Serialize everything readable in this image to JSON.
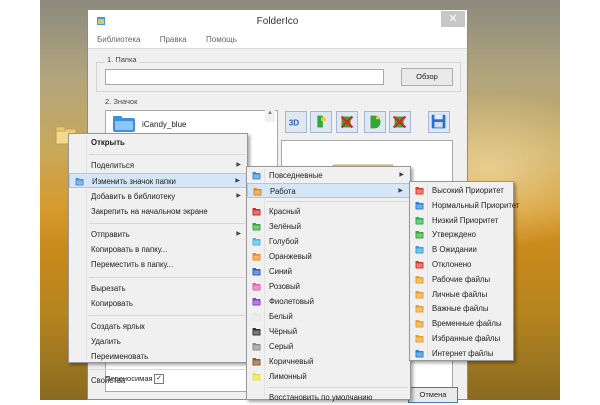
{
  "window": {
    "title": "FolderIco",
    "close_glyph": "✕"
  },
  "menubar": [
    "Библиотека",
    "Правка",
    "Помощь"
  ],
  "folder_group": {
    "label": "1. Папка",
    "path_value": "",
    "browse_label": "Обзор"
  },
  "icon_group": {
    "label": "2. Значок",
    "items": [
      {
        "name": "iCandy_blue"
      }
    ]
  },
  "toolbar_icons": [
    "3d-icon",
    "green-flag-icon",
    "green-x-icon",
    "green-d-icon",
    "red-x-icon",
    "save-icon"
  ],
  "bottom": {
    "checkbox_label": "Переносимая",
    "checkbox_checked": true,
    "checkbox_glyph": "✓",
    "cancel_label": "Отмена"
  },
  "context_menu": {
    "items": [
      {
        "label": "Открыть",
        "bold": true
      },
      {
        "sep": true
      },
      {
        "label": "Поделиться",
        "submenu": true
      },
      {
        "label": "Изменить значок папки",
        "submenu": true,
        "highlight": true,
        "icon": "folder-ico-icon"
      },
      {
        "label": "Добавить в библиотеку",
        "submenu": true
      },
      {
        "label": "Закрепить на начальном экране"
      },
      {
        "sep": true
      },
      {
        "label": "Отправить",
        "submenu": true
      },
      {
        "label": "Копировать в папку..."
      },
      {
        "label": "Переместить в папку..."
      },
      {
        "sep": true
      },
      {
        "label": "Вырезать"
      },
      {
        "label": "Копировать"
      },
      {
        "sep": true
      },
      {
        "label": "Создать ярлык"
      },
      {
        "label": "Удалить"
      },
      {
        "label": "Переименовать"
      },
      {
        "sep": true
      },
      {
        "label": "Свойства"
      }
    ]
  },
  "submenu_icons": {
    "items": [
      {
        "label": "Повседневные",
        "submenu": true,
        "icon": "everyday-icon",
        "color": "#3a8fd9"
      },
      {
        "label": "Работа",
        "submenu": true,
        "highlight": true,
        "icon": "work-icon",
        "color": "#e08a1e"
      },
      {
        "sep": true
      },
      {
        "label": "Красный",
        "icon": "red-folder-icon",
        "color": "#d42a2a"
      },
      {
        "label": "Зелёный",
        "icon": "green-folder-icon",
        "color": "#3aa63a"
      },
      {
        "label": "Голубой",
        "icon": "lightblue-folder-icon",
        "color": "#48b4e8"
      },
      {
        "label": "Оранжевый",
        "icon": "orange-folder-icon",
        "color": "#f08a1c"
      },
      {
        "label": "Синий",
        "icon": "blue-folder-icon",
        "color": "#2c5fd0"
      },
      {
        "label": "Розовый",
        "icon": "pink-folder-icon",
        "color": "#e65fb0"
      },
      {
        "label": "Фиолетовый",
        "icon": "violet-folder-icon",
        "color": "#8a3fc8"
      },
      {
        "label": "Белый",
        "icon": "white-folder-icon",
        "color": "#e6e6e6"
      },
      {
        "label": "Чёрный",
        "icon": "black-folder-icon",
        "color": "#333333"
      },
      {
        "label": "Серый",
        "icon": "gray-folder-icon",
        "color": "#8c8c8c"
      },
      {
        "label": "Коричневый",
        "icon": "brown-folder-icon",
        "color": "#8a5a2a"
      },
      {
        "label": "Лимонный",
        "icon": "lemon-folder-icon",
        "color": "#e6e23a"
      },
      {
        "sep": true
      },
      {
        "label": "Восстановить по умолчанию"
      }
    ]
  },
  "submenu_work": {
    "items": [
      {
        "label": "Высокий Приоритет",
        "icon": "high-priority-icon",
        "color": "#e03b2a"
      },
      {
        "label": "Нормальный Приоритет",
        "icon": "normal-priority-icon",
        "color": "#2b7fd8"
      },
      {
        "label": "Низкий Приоритет",
        "icon": "low-priority-icon",
        "color": "#2bb04a"
      },
      {
        "label": "Утверждено",
        "icon": "approved-icon",
        "color": "#3aa63a"
      },
      {
        "label": "В Ожидании",
        "icon": "pending-icon",
        "color": "#3a9fd8"
      },
      {
        "label": "Отклонено",
        "icon": "rejected-icon",
        "color": "#d83a2a"
      },
      {
        "label": "Рабочие файлы",
        "icon": "work-files-icon",
        "color": "#e8a02a"
      },
      {
        "label": "Личные файлы",
        "icon": "personal-files-icon",
        "color": "#e8a02a"
      },
      {
        "label": "Важные файлы",
        "icon": "important-files-icon",
        "color": "#e8a02a"
      },
      {
        "label": "Временные файлы",
        "icon": "temp-files-icon",
        "color": "#e8a02a"
      },
      {
        "label": "Избранные файлы",
        "icon": "favorite-files-icon",
        "color": "#e8a02a"
      },
      {
        "label": "Интернет файлы",
        "icon": "internet-files-icon",
        "color": "#2b7fd8"
      }
    ]
  }
}
